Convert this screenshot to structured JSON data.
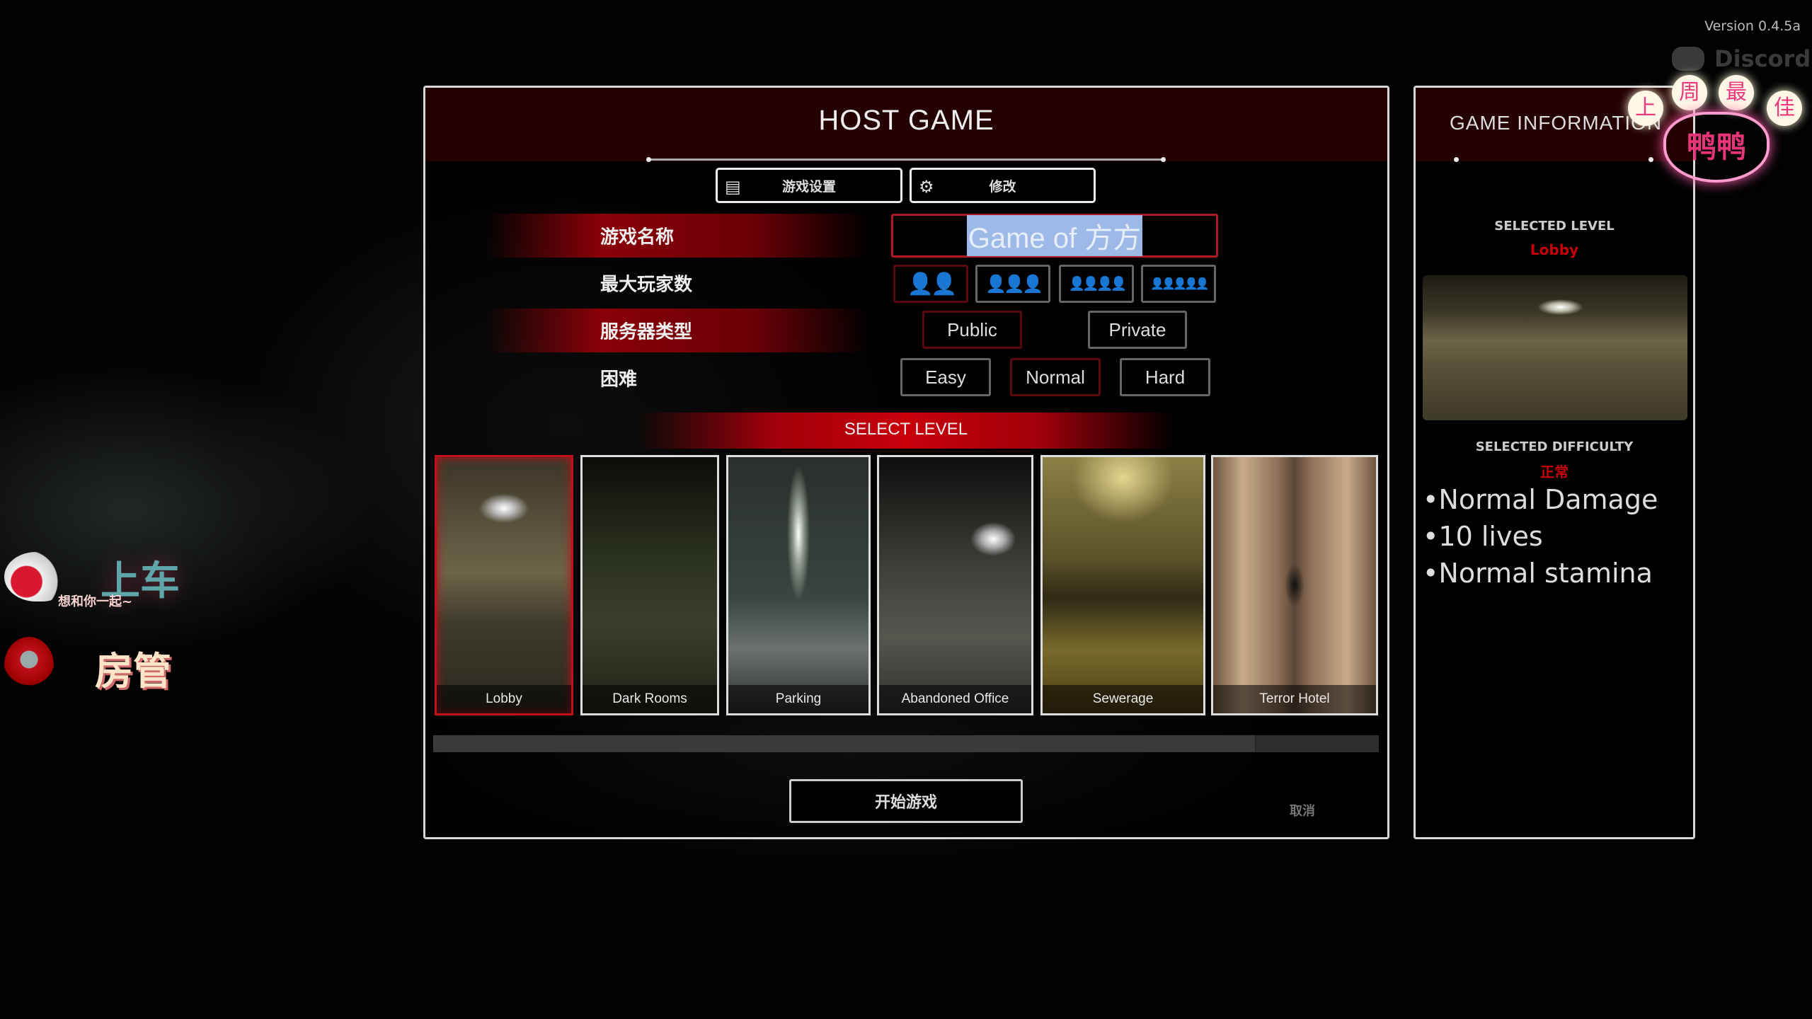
{
  "version": "Version 0.4.5a",
  "discord": "Discord",
  "host": {
    "title": "HOST GAME",
    "tabs": [
      {
        "label": "游戏设置",
        "icon": "list-icon"
      },
      {
        "label": "修改",
        "icon": "gears-icon"
      }
    ],
    "rows": {
      "name_label": "游戏名称",
      "players_label": "最大玩家数",
      "server_label": "服务器类型",
      "difficulty_label": "困难"
    },
    "game_name": "Game of 方方",
    "player_options": [
      2,
      3,
      4,
      5
    ],
    "player_selected": 2,
    "server_options": [
      "Public",
      "Private"
    ],
    "server_selected": "Public",
    "difficulty_options": [
      "Easy",
      "Normal",
      "Hard"
    ],
    "difficulty_selected": "Normal",
    "select_level": "SELECT LEVEL",
    "levels": [
      "Lobby",
      "Dark Rooms",
      "Parking",
      "Abandoned Office",
      "Sewerage",
      "Terror Hotel"
    ],
    "level_selected": "Lobby",
    "start": "开始游戏",
    "cancel": "取消"
  },
  "info": {
    "title": "GAME INFORMATION",
    "selected_level_label": "SELECTED LEVEL",
    "selected_level": "Lobby",
    "selected_difficulty_label": "SELECTED DIFFICULTY",
    "selected_difficulty": "正常",
    "bullets": [
      "•Normal Damage",
      "•10 lives",
      "•Normal stamina"
    ]
  },
  "overlay": {
    "badge_top": [
      "上",
      "周",
      "最",
      "佳"
    ],
    "badge_name": "鸭鸭",
    "sticker1": "上车",
    "sticker1_sub": "想和你一起~",
    "sticker2": "房管"
  },
  "colors": {
    "accent": "#c8000a",
    "header": "#250003",
    "highlight": "#9db9e8"
  }
}
